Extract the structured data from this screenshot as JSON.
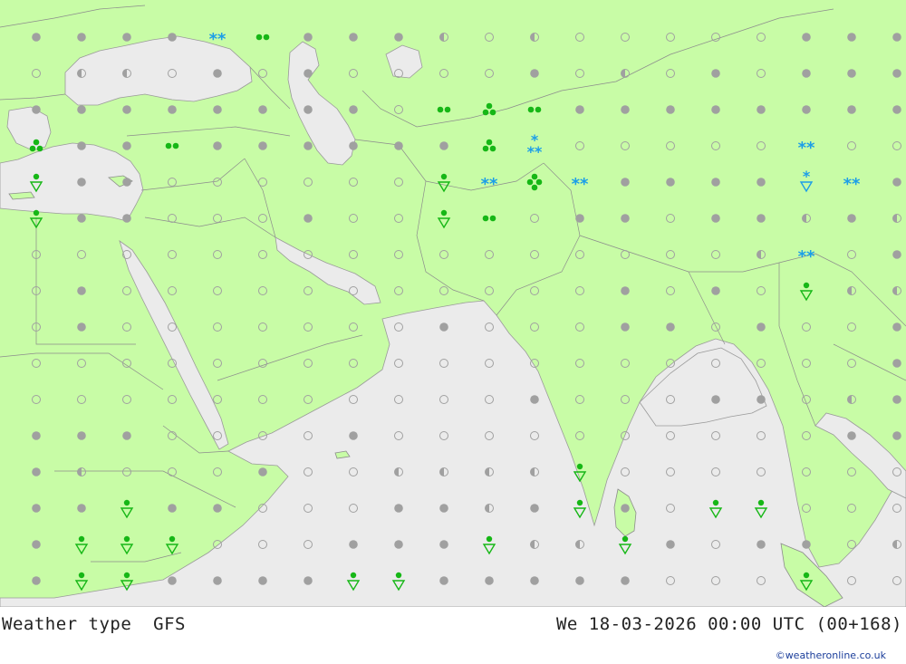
{
  "footer": {
    "title": "Weather type",
    "model": "GFS",
    "valid_time": "We 18-03-2026 00:00 UTC (00+168)",
    "credit": "©weatheronline.co.uk"
  },
  "colors": {
    "land": "#c8fca6",
    "sea": "#ebebeb",
    "border": "#8c8c8c",
    "overcast": "#a0a0a0",
    "rain_symbol": "#16b716",
    "snow_symbol": "#1c9ee8",
    "credit": "#1a3d9a"
  },
  "legend_symbols": {
    "overcast": "filled-grey-dot",
    "cloudy": "half-filled-dot",
    "clear": "open-circle",
    "showers": "rain-shower-triangle",
    "rain": "two-green-dots",
    "heavy_rain": "three-green-dots",
    "thunder_rain": "four-green-dots",
    "snow": "blue-asterisks",
    "snow_shower": "blue-asterisk-triangle"
  },
  "grid": {
    "rows": [
      "OOOOOOOOOHEHEEEEEOOOOOOOOE",
      "EHHEOEOEEEEOEHEOEOOOOOOOOO",
      "OOOOOOOOEEHOOOOOOOOOOOOOOO",
      "OOOOOOOOOOOEEEEEEEEEEEEOOO",
      "OOOEEEEEEEEOEOOOOOOOEOOOOO",
      "OOOEEEOEEEEEOOEOOHOHEOOHEO",
      "EEEEEEEEEEEEEEEEHHEOOHEHOE",
      "EOEEEEEEEEEEEOEOEHHHHHHOOH",
      "EOEEEEEEEOEEEOOEOEEOOOHHOH",
      "EEEEEEEEEEEEEEEEEEEOOEEOEE",
      "EEEEEEEEEEEOEEEOOEHOOOOOOO",
      "OOOEEEEOEEEEEEEEEEOOOOEOOE",
      "OHEEEOEEHHHHHEEEEEEEEOEEOE",
      "OOOOOEEEOOHOOOEEEEEEEHHOOE",
      "OOOOEEEOOOHHHOOEOOEHEHHOOO",
      "OOOOOOOOOOOOOOEEEEEEEOEEOO"
    ],
    "weather": [
      {
        "row": 0,
        "col": 4,
        "type": "snow"
      },
      {
        "row": 0,
        "col": 5,
        "type": "rain"
      },
      {
        "row": 2,
        "col": 9,
        "type": "rain"
      },
      {
        "row": 2,
        "col": 10,
        "type": "heavy_rain"
      },
      {
        "row": 2,
        "col": 11,
        "type": "rain"
      },
      {
        "row": 3,
        "col": 0,
        "type": "heavy_rain"
      },
      {
        "row": 3,
        "col": 3,
        "type": "rain"
      },
      {
        "row": 3,
        "col": 10,
        "type": "heavy_rain"
      },
      {
        "row": 3,
        "col": 11,
        "type": "snow_cluster"
      },
      {
        "row": 3,
        "col": 17,
        "type": "snow"
      },
      {
        "row": 4,
        "col": 0,
        "type": "showers"
      },
      {
        "row": 4,
        "col": 9,
        "type": "showers"
      },
      {
        "row": 4,
        "col": 10,
        "type": "snow"
      },
      {
        "row": 4,
        "col": 11,
        "type": "thunder_rain"
      },
      {
        "row": 4,
        "col": 12,
        "type": "snow"
      },
      {
        "row": 4,
        "col": 17,
        "type": "snow_shower"
      },
      {
        "row": 4,
        "col": 18,
        "type": "snow"
      },
      {
        "row": 5,
        "col": 0,
        "type": "showers"
      },
      {
        "row": 5,
        "col": 9,
        "type": "showers"
      },
      {
        "row": 5,
        "col": 10,
        "type": "rain"
      },
      {
        "row": 6,
        "col": 17,
        "type": "snow"
      },
      {
        "row": 7,
        "col": 17,
        "type": "showers"
      },
      {
        "row": 12,
        "col": 12,
        "type": "showers"
      },
      {
        "row": 13,
        "col": 2,
        "type": "showers"
      },
      {
        "row": 13,
        "col": 12,
        "type": "showers"
      },
      {
        "row": 13,
        "col": 15,
        "type": "showers"
      },
      {
        "row": 13,
        "col": 16,
        "type": "showers"
      },
      {
        "row": 14,
        "col": 1,
        "type": "showers"
      },
      {
        "row": 14,
        "col": 2,
        "type": "showers"
      },
      {
        "row": 14,
        "col": 3,
        "type": "showers"
      },
      {
        "row": 14,
        "col": 10,
        "type": "showers"
      },
      {
        "row": 14,
        "col": 13,
        "type": "showers"
      },
      {
        "row": 15,
        "col": 1,
        "type": "showers"
      },
      {
        "row": 15,
        "col": 2,
        "type": "showers"
      },
      {
        "row": 15,
        "col": 7,
        "type": "showers"
      },
      {
        "row": 15,
        "col": 8,
        "type": "showers"
      },
      {
        "row": 15,
        "col": 17,
        "type": "showers"
      }
    ]
  }
}
